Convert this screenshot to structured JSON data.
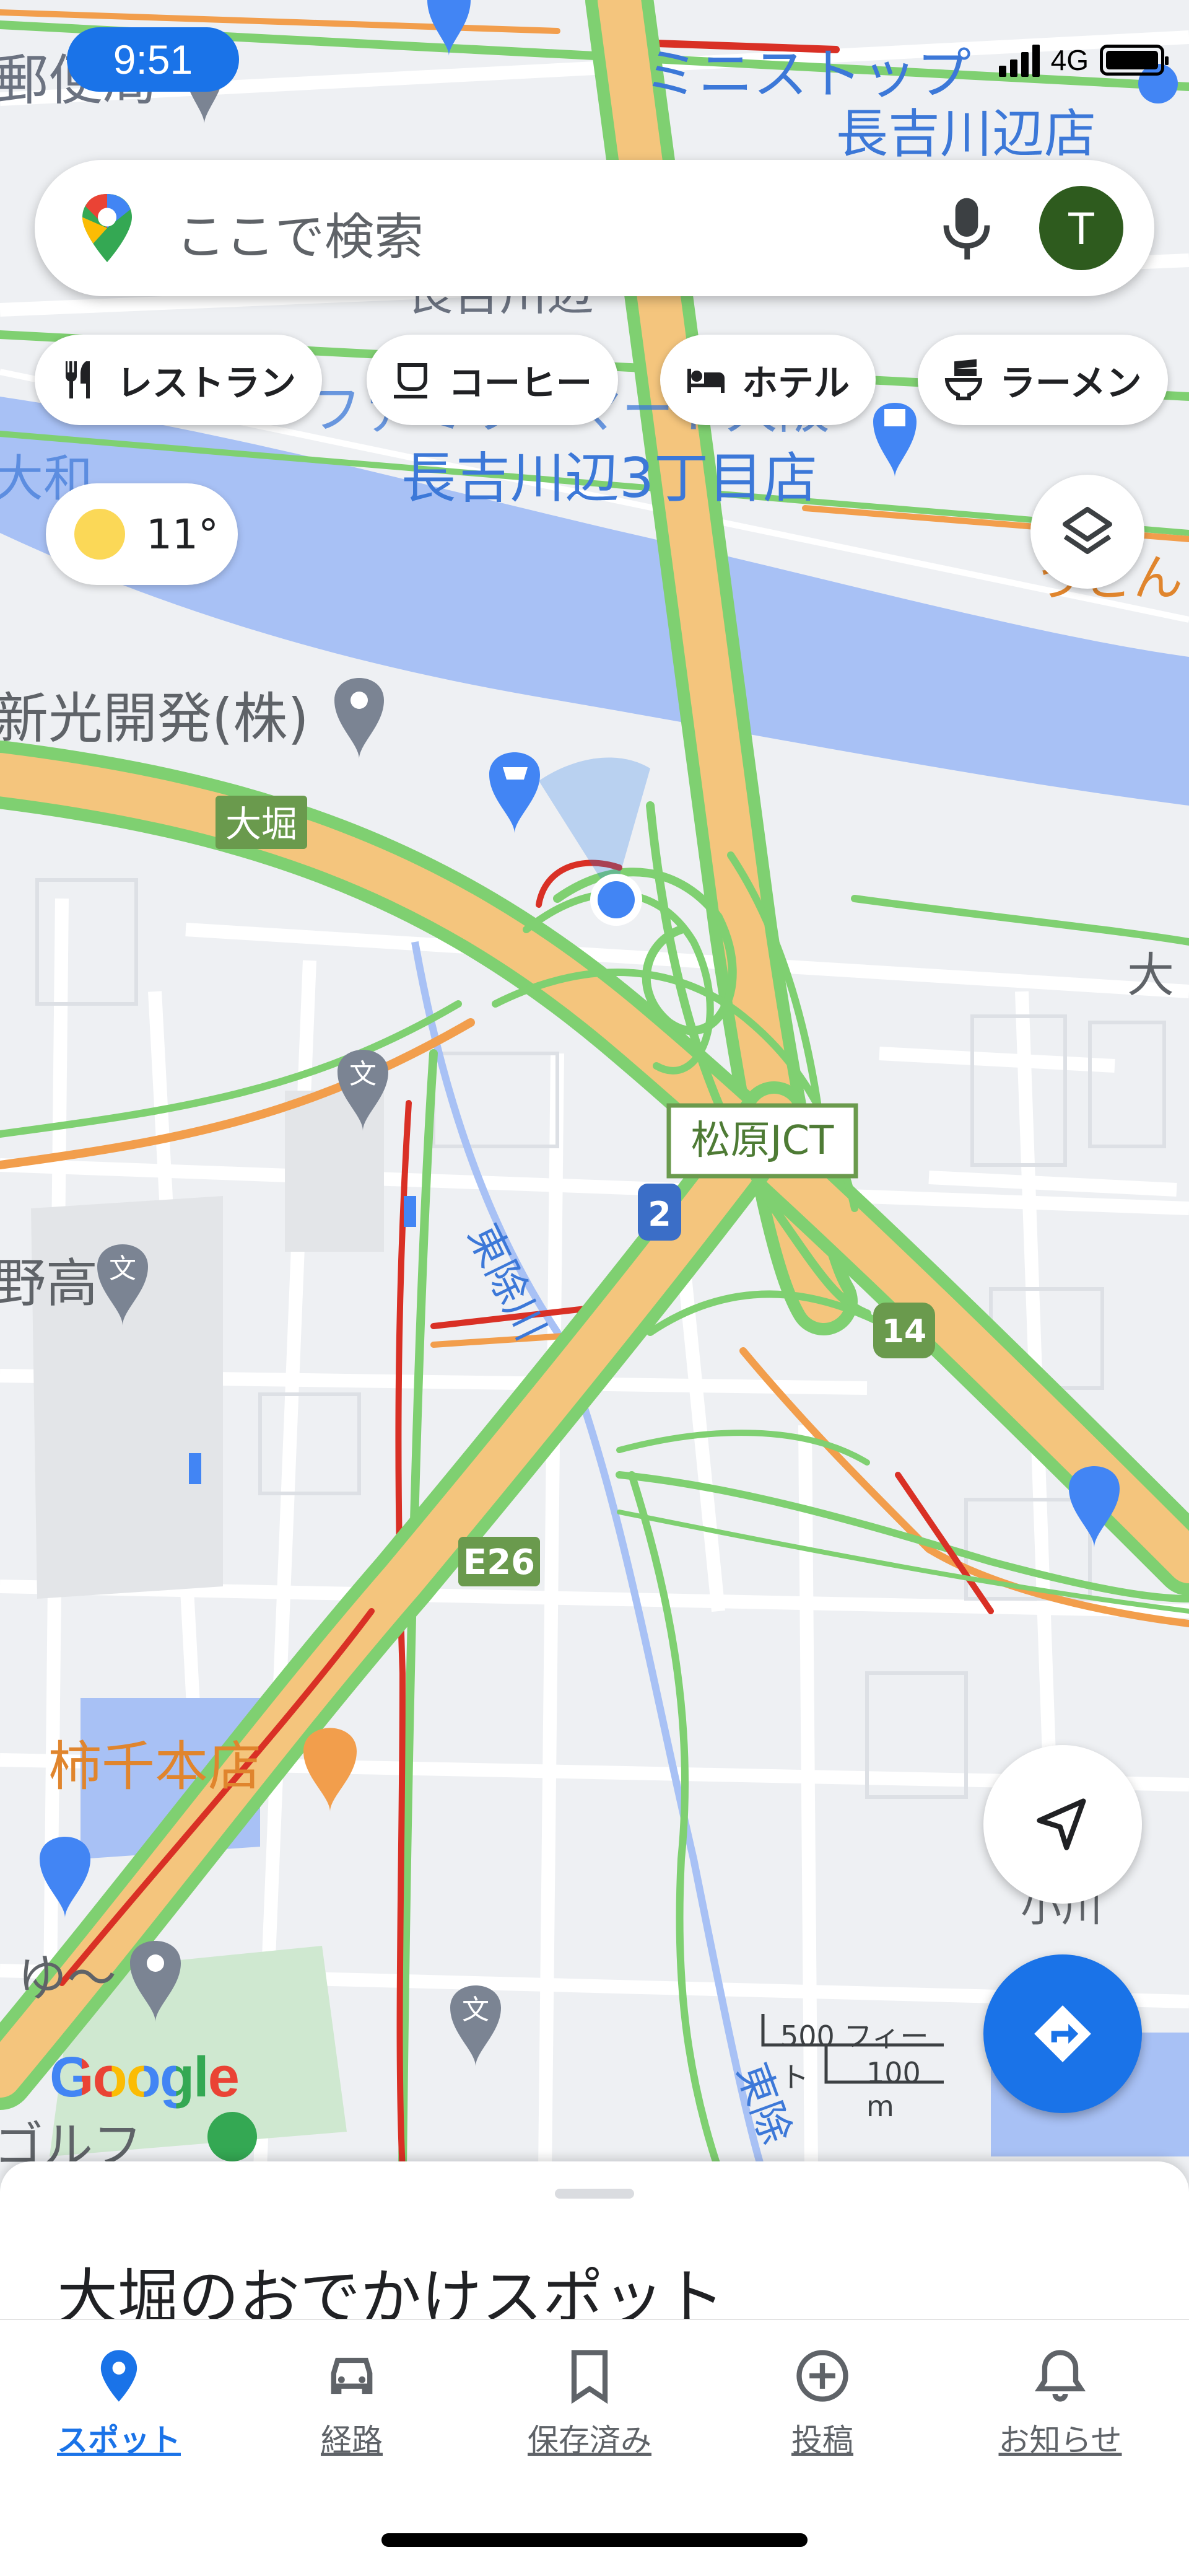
{
  "status_bar": {
    "time": "9:51",
    "network": "4G"
  },
  "search": {
    "placeholder": "ここで検索",
    "avatar_initial": "T"
  },
  "chips": [
    {
      "label": "レストラン",
      "icon": "fork-knife-icon"
    },
    {
      "label": "コーヒー",
      "icon": "coffee-cup-icon"
    },
    {
      "label": "ホテル",
      "icon": "bed-icon"
    },
    {
      "label": "ラーメン",
      "icon": "ramen-bowl-icon"
    }
  ],
  "weather": {
    "temp": "11°",
    "icon": "sun-icon"
  },
  "map_labels": {
    "post_office": "郵便局",
    "ministop": "ミニストップ",
    "ministop_branch": "長吉川辺店",
    "nagayoshi": "長吉川辺",
    "family_mart": "ファミリーマート大阪",
    "family_mart_branch": "長吉川辺3丁目店",
    "yamato": "大和",
    "udon": "うどん",
    "shinko": "新光開発(株)",
    "ohori": "大堀",
    "matsubara_jct": "松原JCT",
    "higashi_yokekawa": "東除川",
    "highschool": "野高",
    "kakinomoto": "柿千本店",
    "yu": "ゆ～",
    "golf": "ゴルフ",
    "east_right": "大",
    "ogawa": "小川",
    "higashi2": "東除",
    "route_2": "2",
    "route_14": "14",
    "route_e26": "E26"
  },
  "scale": {
    "feet": "500 フィート",
    "meters": "100 m"
  },
  "attribution": "Google",
  "sheet": {
    "title": "大堀のおでかけスポット"
  },
  "nav": [
    {
      "label": "スポット",
      "icon": "location-pin-icon",
      "active": true
    },
    {
      "label": "経路",
      "icon": "car-icon",
      "active": false
    },
    {
      "label": "保存済み",
      "icon": "bookmark-icon",
      "active": false
    },
    {
      "label": "投稿",
      "icon": "add-circle-icon",
      "active": false
    },
    {
      "label": "お知らせ",
      "icon": "bell-icon",
      "active": false
    }
  ],
  "colors": {
    "accent": "#1a73e8",
    "highway": "#f4c57d",
    "traffic_green": "#7fd071",
    "traffic_red": "#d93025",
    "water": "#a8c1f5",
    "park": "#cfe8d0"
  }
}
